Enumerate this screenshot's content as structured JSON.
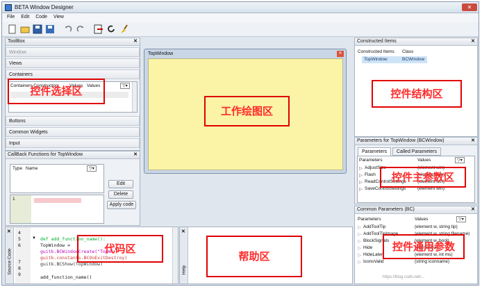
{
  "window": {
    "title": "BETA Window Designer"
  },
  "menu": [
    "File",
    "Edit",
    "Code",
    "View"
  ],
  "toolbox": {
    "title": "ToolBox",
    "window_label": "Window",
    "views_label": "Views",
    "containers_label": "Containers",
    "containers_table_headers": [
      "Containers Constructors",
      "Values",
      "Values"
    ],
    "buttons_label": "Buttons",
    "common_widgets_label": "Common Widgets",
    "input_label": "Input"
  },
  "callback": {
    "title": "CallBack Functions for TopWindow",
    "headers": [
      "Type",
      "Name"
    ],
    "row_number": "1",
    "edit_label": "Edit",
    "delete_label": "Delete",
    "apply_label": "Apply code"
  },
  "canvas": {
    "window_title": "TopWindow"
  },
  "constructed": {
    "title": "Constructed Items",
    "headers": [
      "Constructed Items",
      "Class"
    ],
    "row": {
      "item": "TopWindow",
      "class": "BCWindow"
    }
  },
  "params": {
    "title": "Parameters for TopWindow (BCWindow)",
    "tabs": [
      "Parameters",
      "Called Parameters"
    ],
    "headers": [
      "Parameters",
      "Values"
    ],
    "rows": [
      {
        "name": "AdjustSize",
        "value": "(element win)"
      },
      {
        "name": "Flash",
        "value": "(element win)"
      },
      {
        "name": "ReadControlSettings",
        "value": "(element win)"
      },
      {
        "name": "SaveControlSettings",
        "value": "(element win)"
      }
    ]
  },
  "common": {
    "title": "Common Parameters (BC)",
    "headers": [
      "Parameters",
      "Values"
    ],
    "rows": [
      {
        "name": "AddToolTip",
        "value": "(element w, string tip)"
      },
      {
        "name": "AddToolTipImage",
        "value": "(element w, string filename)"
      },
      {
        "name": "BlockSignals",
        "value": "(element w, bool)"
      },
      {
        "name": "Hide",
        "value": "(element w)"
      },
      {
        "name": "HideLater",
        "value": "(element w, int ms)"
      },
      {
        "name": "IconsValid",
        "value": "(string iconname)"
      }
    ]
  },
  "source": {
    "side_label": "Source Code",
    "line_numbers": [
      "4",
      "5",
      "6",
      "",
      "7",
      "8",
      "9"
    ],
    "lines": [
      "",
      "def add_function_name():",
      "    TopWindow =",
      "guitk.BCWindowCreate(\"TopWi",
      "guitk.constants.BCOnExitDestroy)",
      "    guitk.BCShow(TopWindow)",
      "",
      "add_function_name()"
    ]
  },
  "help": {
    "side_label": "Help"
  },
  "annotations": {
    "widget_select": "控件选择区",
    "work_draw": "工作绘图区",
    "widget_struct": "控件结构区",
    "main_params": "控件主参数区",
    "common_params": "控件通用参数",
    "code": "代码区",
    "help": "帮助区"
  },
  "watermark": "https://blog.csdn.net/..."
}
